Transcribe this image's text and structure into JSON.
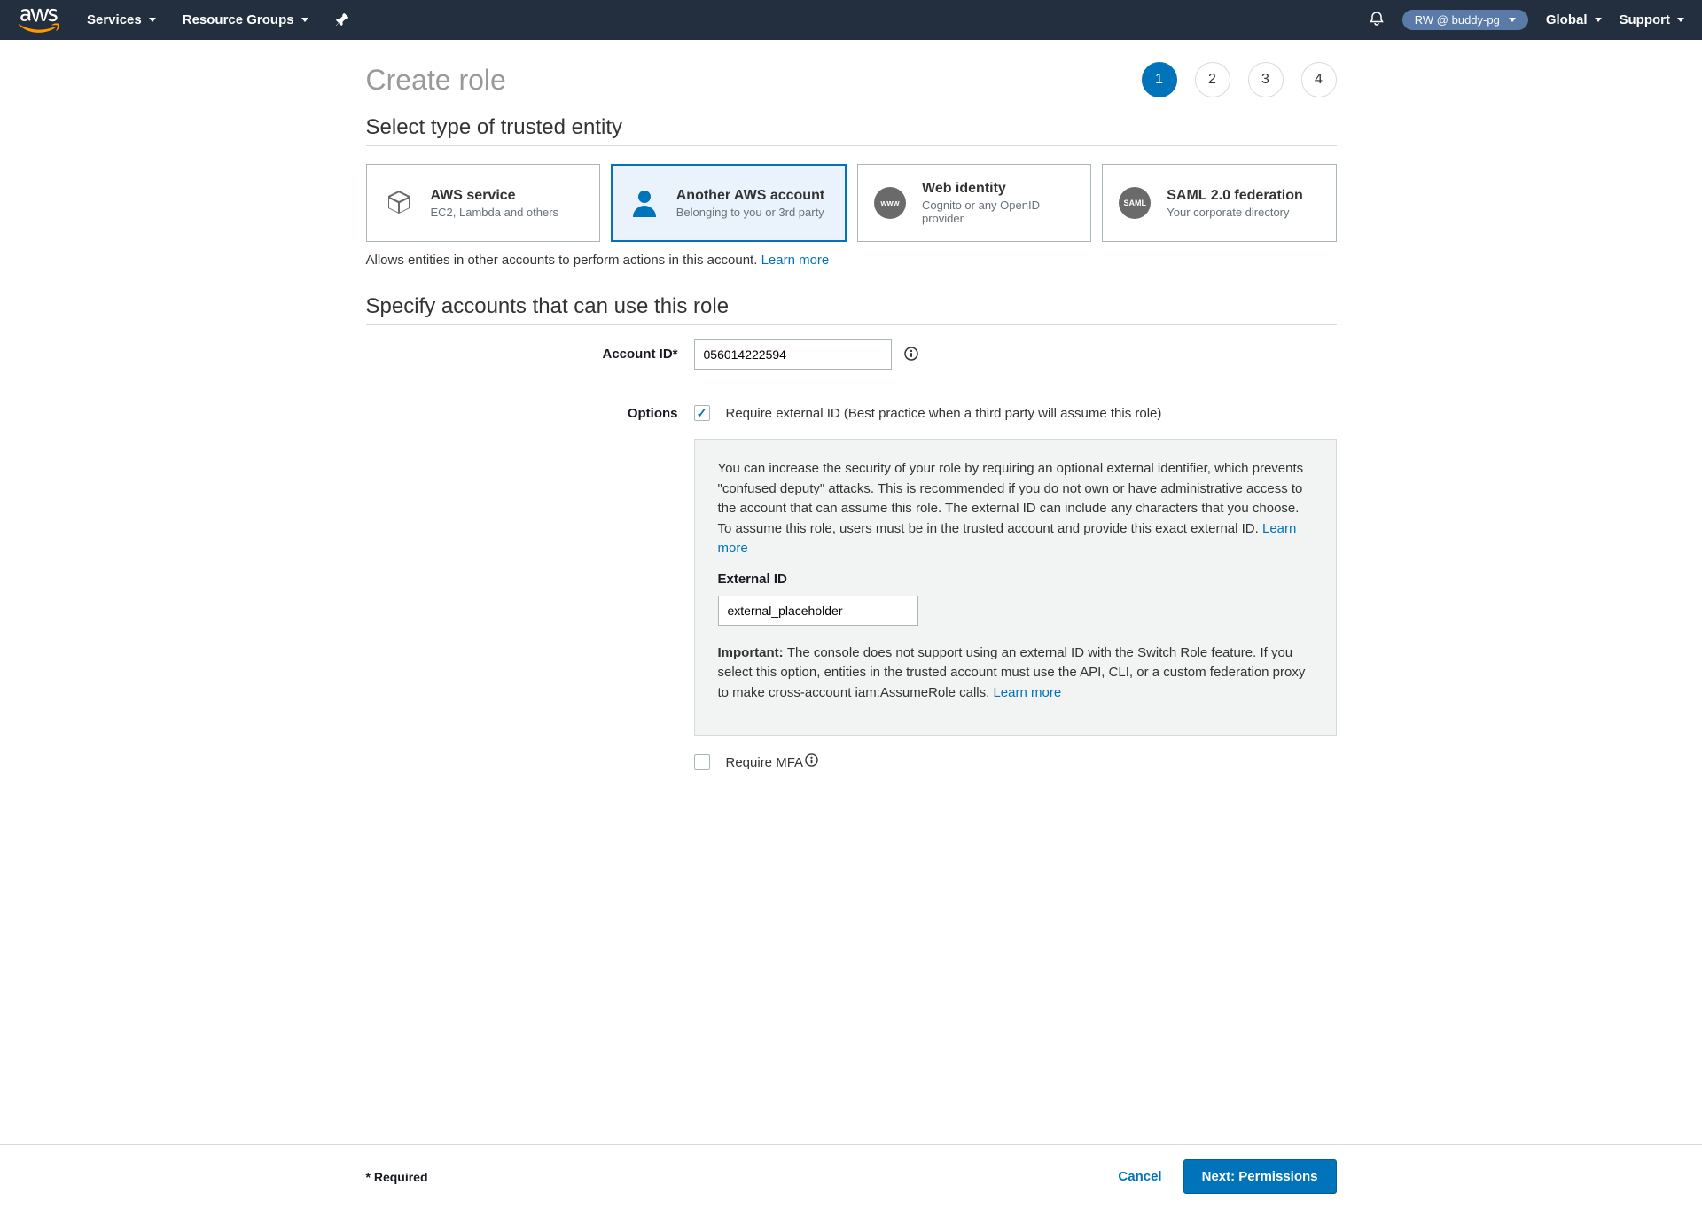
{
  "nav": {
    "services": "Services",
    "resourceGroups": "Resource Groups",
    "account": "RW @ buddy-pg",
    "global": "Global",
    "support": "Support"
  },
  "page": {
    "title": "Create role",
    "steps": [
      "1",
      "2",
      "3",
      "4"
    ],
    "activeStep": 0
  },
  "entitySection": {
    "title": "Select type of trusted entity",
    "cards": [
      {
        "title": "AWS service",
        "sub": "EC2, Lambda and others"
      },
      {
        "title": "Another AWS account",
        "sub": "Belonging to you or 3rd party"
      },
      {
        "title": "Web identity",
        "sub": "Cognito or any OpenID provider"
      },
      {
        "title": "SAML 2.0 federation",
        "sub": "Your corporate directory"
      }
    ],
    "desc": "Allows entities in other accounts to perform actions in this account. ",
    "learnMore": "Learn more"
  },
  "accountSection": {
    "title": "Specify accounts that can use this role",
    "accountIdLabel": "Account ID*",
    "accountIdValue": "056014222594",
    "optionsLabel": "Options",
    "requireExternalLabel": "Require external ID (Best practice when a third party will assume this role)",
    "infoText": "You can increase the security of your role by requiring an optional external identifier, which prevents \"confused deputy\" attacks. This is recommended if you do not own or have administrative access to the account that can assume this role. The external ID can include any characters that you choose. To assume this role, users must be in the trusted account and provide this exact external ID. ",
    "infoLearnMore": "Learn more",
    "externalIdLabel": "External ID",
    "externalIdValue": "external_placeholder",
    "importantPrefix": "Important: ",
    "importantText": "The console does not support using an external ID with the Switch Role feature. If you select this option, entities in the trusted account must use the API, CLI, or a custom federation proxy to make cross-account iam:AssumeRole calls. ",
    "importantLearnMore": "Learn more",
    "requireMfaLabel": "Require MFA"
  },
  "footer": {
    "required": "* Required",
    "cancel": "Cancel",
    "next": "Next: Permissions"
  },
  "icons": {
    "www": "www",
    "saml": "SAML"
  }
}
